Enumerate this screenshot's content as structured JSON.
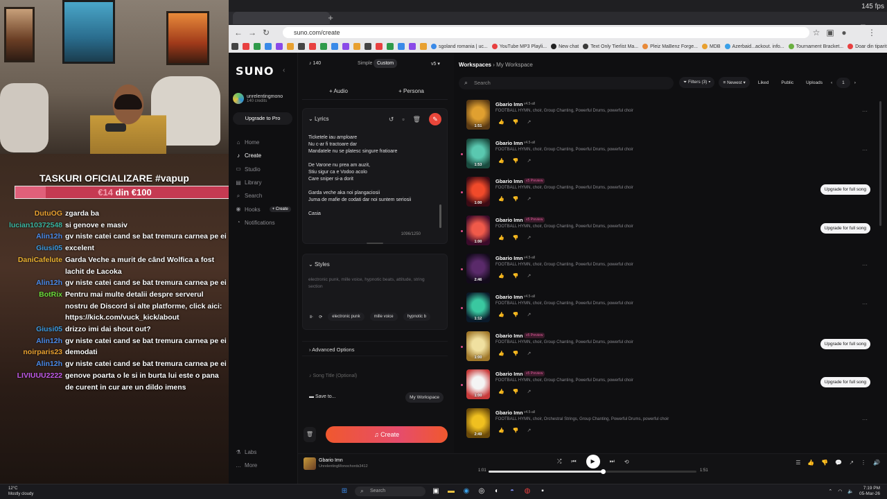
{
  "stream": {
    "fps": "145 fps",
    "goal_title": "TASKURI OFICIALIZARE #vapup",
    "goal_current": "€14",
    "goal_rest": " din €100",
    "goal_progress": 0.14,
    "chat": [
      {
        "user": "DutuOG",
        "msg": "zgarda ba",
        "color": "#e8a030"
      },
      {
        "user": "lucian10372548",
        "msg": "si genove e masiv",
        "color": "#3ab5a0"
      },
      {
        "user": "Alin12h",
        "msg": "gv niste catei cand se bat tremura carnea pe ei",
        "color": "#4a8ae8"
      },
      {
        "user": "Giusi05",
        "msg": "excelent",
        "color": "#3a9ae0"
      },
      {
        "user": "DaniCafelute",
        "msg": "Garda Veche a murit de când Wolfica a fost lachit de Lacoka",
        "color": "#e8b030"
      },
      {
        "user": "Alin12h",
        "msg": "gv niste catei cand se bat tremura carnea pe ei",
        "color": "#4a8ae8"
      },
      {
        "user": "BotRix",
        "msg": "Pentru mai multe detalii despre serverul nostru de Discord si alte platforme, click aici: https://kick.com/vuck_kick/about",
        "color": "#6adc3a"
      },
      {
        "user": "Giusi05",
        "msg": "drizzo imi dai shout out?",
        "color": "#3a9ae0"
      },
      {
        "user": "Alin12h",
        "msg": "gv niste catei cand se bat tremura carnea pe ei",
        "color": "#4a8ae8"
      },
      {
        "user": "noirparis23",
        "msg": "demodati",
        "color": "#e8a030"
      },
      {
        "user": "Alin12h",
        "msg": "gv niste catei cand se bat tremura carnea pe ei",
        "color": "#4a8ae8"
      },
      {
        "user": "LIVIUUU2222",
        "msg": "genove poarta o le si in burta lui este o pana de curent in cur are un dildo imens",
        "color": "#c05ae8"
      }
    ]
  },
  "browser": {
    "url": "suno.com/create",
    "bookmarks": [
      "sgoland romania | uc...",
      "YouTube MP3 Playli...",
      "New chat",
      "Text Only Tierlist Ma...",
      "Pleiz MaBenz Forge...",
      "MDB",
      "Azerbaid...ackout. info...",
      "Tournament Bracket...",
      "Doar din tiparitel"
    ]
  },
  "app": {
    "logo": "SUNO",
    "user_name": "unrelentingmono",
    "user_credits": "140 credits",
    "upgrade_label": "Upgrade to Pro",
    "nav": [
      {
        "label": "Home",
        "icon": "⌂",
        "active": false
      },
      {
        "label": "Create",
        "icon": "♪",
        "active": true
      },
      {
        "label": "Studio",
        "icon": "▭",
        "active": false
      },
      {
        "label": "Library",
        "icon": "▤",
        "active": false
      },
      {
        "label": "Search",
        "icon": "⌕",
        "active": false
      },
      {
        "label": "Hooks",
        "icon": "◉",
        "active": false
      },
      {
        "label": "Notifications",
        "icon": "◔",
        "active": false
      }
    ],
    "hooks_create": "+ Create",
    "nav_bottom": [
      {
        "label": "Labs",
        "icon": "⚗"
      },
      {
        "label": "More",
        "icon": "…"
      }
    ],
    "create": {
      "credits": "140",
      "mode_simple": "Simple",
      "mode_custom": "Custom",
      "version": "v5",
      "audio_label": "Audio",
      "persona_label": "Persona",
      "lyrics_label": "Lyrics",
      "lyrics_text": "Ticketele iau amploare\nNu c-ar fi tractoare dar\nMandatele nu se platesc singure fratioare\n\nDe Varone nu prea am auzit,\nStiu sigur ca e Vodoo acolo\nCare sniper si-a dorit\n\nGarda veche aka noi plangaciosii\nJuma de mafie de codati dar noi suntem seriosii\n\nCasia",
      "char_count": "1096/1250",
      "styles_label": "Styles",
      "styles_placeholder": "electronic punk, mille voice, hypnotic beats, attitude, string section",
      "chips": [
        "electronic punk",
        "mille voice",
        "hypnotic b"
      ],
      "advanced_label": "Advanced Options",
      "song_title_placeholder": "Song Title (Optional)",
      "save_to_label": "Save to...",
      "workspace_pill": "My Workspace",
      "create_label": "Create"
    },
    "workspace": {
      "crumb_root": "Workspaces",
      "crumb_current": "My Workspace",
      "search_placeholder": "Search",
      "filters": "Filters (3)",
      "sort": "Newest",
      "liked": "Liked",
      "public": "Public",
      "uploads": "Uploads",
      "page": "1",
      "upgrade_label": "Upgrade for full song",
      "songs": [
        {
          "title": "Gbario Imn",
          "ver": "v4.5-all",
          "preview": false,
          "tags": "FOOTBALL HYMN, choir, Group Chanting, Powerful Drums, powerful choir",
          "dur": "1:51",
          "c1": "#e0a030",
          "c2": "#5a3a14"
        },
        {
          "title": "Gbario Imn",
          "ver": "v4.5-all",
          "preview": false,
          "tags": "FOOTBALL HYMN, choir, Group Chanting, Powerful Drums, powerful choir",
          "dur": "1:53",
          "c1": "#5ac8b0",
          "c2": "#1a4a3e"
        },
        {
          "title": "Gbario Imn",
          "ver": "v5 Preview",
          "preview": true,
          "tags": "FOOTBALL HYMN, choir, Group Chanting, Powerful Drums, powerful choir",
          "dur": "1:00",
          "c1": "#f04a2a",
          "c2": "#3a0a14"
        },
        {
          "title": "Gbario Imn",
          "ver": "v5 Preview",
          "preview": true,
          "tags": "FOOTBALL HYMN, choir, Group Chanting, Powerful Drums, powerful choir",
          "dur": "1:00",
          "c1": "#f05a4a",
          "c2": "#3a0a2a"
        },
        {
          "title": "Gbario Imn",
          "ver": "v4.5-all",
          "preview": false,
          "tags": "FOOTBALL HYMN, choir, Group Chanting, Powerful Drums, powerful choir",
          "dur": "2:46",
          "c1": "#5a2a6a",
          "c2": "#120a1a"
        },
        {
          "title": "Gbario Imn",
          "ver": "v4.5-all",
          "preview": false,
          "tags": "FOOTBALL HYMN, choir, Group Chanting, Powerful Drums, powerful choir",
          "dur": "1:12",
          "c1": "#3ac8a0",
          "c2": "#0a1a2a"
        },
        {
          "title": "Gbario Imn",
          "ver": "v5 Preview",
          "preview": true,
          "tags": "FOOTBALL HYMN, choir, Group Chanting, Powerful Drums, powerful choir",
          "dur": "1:00",
          "c1": "#f0e0a0",
          "c2": "#a0782a"
        },
        {
          "title": "Gbario Imn",
          "ver": "v5 Preview",
          "preview": true,
          "tags": "FOOTBALL HYMN, choir, Group Chanting, Powerful Drums, powerful choir",
          "dur": "1:00",
          "c1": "#f4f4f4",
          "c2": "#c83a3a"
        },
        {
          "title": "Gbario Imn",
          "ver": "v4.5-all",
          "preview": false,
          "tags": "FOOTBALL HYMN, choir, Orchestral Strings, Group Chanting, Powerful Drums, powerful choir",
          "dur": "2:49",
          "c1": "#f0c020",
          "c2": "#6a4a0a"
        }
      ]
    },
    "player": {
      "title": "Gbario Imn",
      "artist": "UnrelentingMonochords3412",
      "time_current": "1:01",
      "time_total": "1:51",
      "progress": 0.55
    }
  },
  "taskbar": {
    "temp": "12°C",
    "weather": "Mostly cloudy",
    "search": "Search",
    "time": "7:19 PM",
    "date": "05-Mar-26"
  }
}
